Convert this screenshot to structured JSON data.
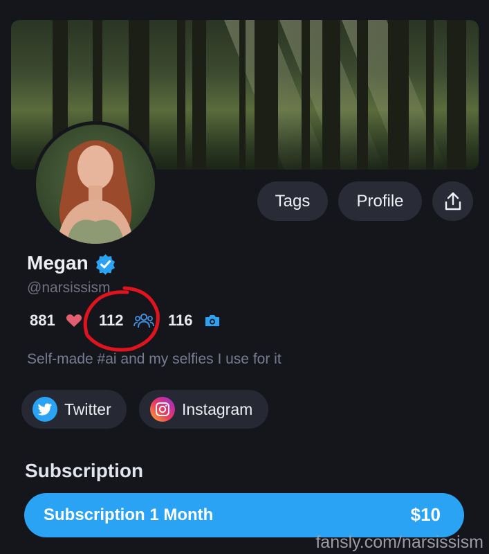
{
  "profile": {
    "name": "Megan",
    "handle": "@narsissism",
    "bio": "Self-made #ai and my selfies I use for it"
  },
  "actions": {
    "tags": "Tags",
    "profile": "Profile"
  },
  "stats": {
    "likes": "881",
    "subscribers": "112",
    "media": "116"
  },
  "links": {
    "twitter": "Twitter",
    "instagram": "Instagram"
  },
  "subscription": {
    "section_title": "Subscription",
    "plan_label": "Subscription 1 Month",
    "price": "$10"
  },
  "watermark": "fansly.com/narsissism",
  "colors": {
    "accent": "#2ba3f5",
    "heart": "#e25f6f",
    "annotation": "#e0141e"
  },
  "icons": [
    "verified-badge-icon",
    "share-icon",
    "heart-icon",
    "people-icon",
    "camera-icon",
    "twitter-icon",
    "instagram-icon"
  ]
}
